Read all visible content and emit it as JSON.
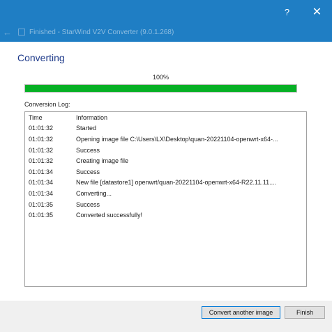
{
  "window": {
    "title": "Finished - StarWind V2V Converter (9.0.1.268)",
    "help_icon": "?",
    "close_icon": "✕",
    "back_icon": "←"
  },
  "page": {
    "heading": "Converting"
  },
  "progress": {
    "label": "100%",
    "value_percent": 100,
    "color": "#06b025"
  },
  "log": {
    "label": "Conversion Log:",
    "columns": [
      "Time",
      "Information"
    ],
    "rows": [
      {
        "time": "01:01:32",
        "info": "Started"
      },
      {
        "time": "01:01:32",
        "info": "Opening image file C:\\Users\\LX\\Desktop\\quan-20221104-openwrt-x64-..."
      },
      {
        "time": "01:01:32",
        "info": "Success"
      },
      {
        "time": "01:01:32",
        "info": "Creating image file"
      },
      {
        "time": "01:01:34",
        "info": "Success"
      },
      {
        "time": "01:01:34",
        "info": "New file [datastore1] openwrt/quan-20221104-openwrt-x64-R22.11.11...."
      },
      {
        "time": "01:01:34",
        "info": "Converting..."
      },
      {
        "time": "01:01:35",
        "info": "Success"
      },
      {
        "time": "01:01:35",
        "info": "Converted successfully!"
      }
    ]
  },
  "buttons": {
    "convert_another": "Convert another image",
    "finish": "Finish"
  },
  "colors": {
    "titlebar": "#1f7ec4",
    "heading": "#1e3a8a"
  }
}
